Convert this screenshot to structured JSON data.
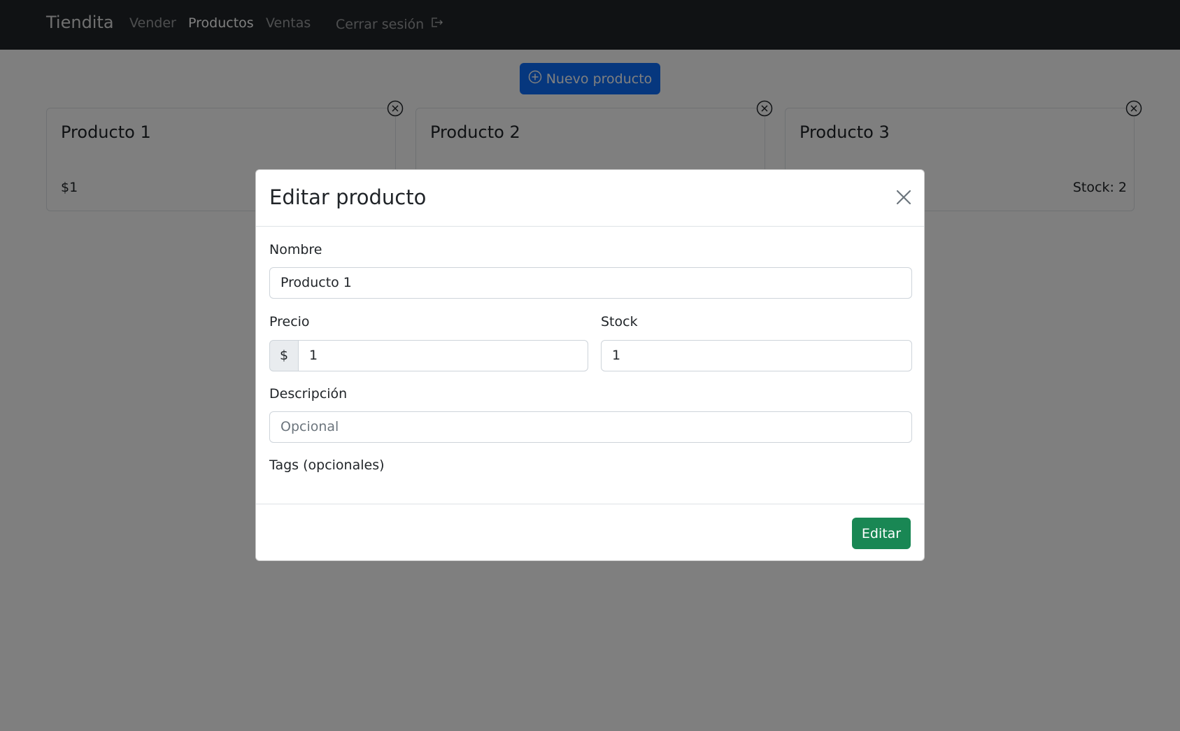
{
  "nav": {
    "brand": "Tiendita",
    "links": [
      {
        "label": "Vender",
        "active": false
      },
      {
        "label": "Productos",
        "active": true
      },
      {
        "label": "Ventas",
        "active": false
      }
    ],
    "logout_label": "Cerrar sesión",
    "logout_icon": "box-arrow-right-icon"
  },
  "toolbar": {
    "new_product_label": "Nuevo producto",
    "new_product_icon": "plus-circle-icon"
  },
  "products": [
    {
      "name": "Producto 1",
      "price": "$1",
      "stock": ""
    },
    {
      "name": "Producto 2",
      "price": "",
      "stock": ""
    },
    {
      "name": "Producto 3",
      "price": "",
      "stock": "Stock: 2"
    }
  ],
  "modal": {
    "title": "Editar producto",
    "close_icon": "x-icon",
    "fields": {
      "name_label": "Nombre",
      "name_value": "Producto 1",
      "price_label": "Precio",
      "price_prefix": "$",
      "price_value": "1",
      "stock_label": "Stock",
      "stock_value": "1",
      "description_label": "Descripción",
      "description_placeholder": "Opcional",
      "tags_label": "Tags (opcionales)"
    },
    "submit_label": "Editar"
  },
  "colors": {
    "navbar": "#212529",
    "primary": "#0d6efd",
    "success": "#198754",
    "backdrop": "rgba(0,0,0,0.5)"
  }
}
